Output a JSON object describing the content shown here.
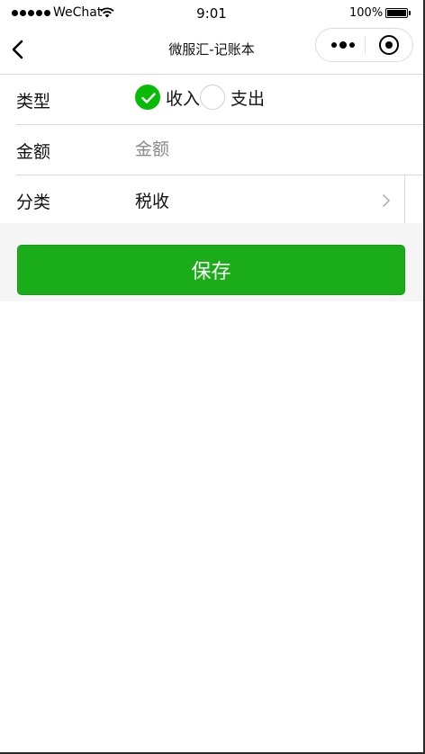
{
  "status_bar": {
    "carrier": "WeChat",
    "time": "9:01",
    "battery": "100%",
    "battery_level": 1.0
  },
  "nav": {
    "title": "微服汇-记账本",
    "back_icon": "chevron-left-icon",
    "more_icon": "more-dots-icon",
    "close_icon": "target-circle-icon"
  },
  "form": {
    "type": {
      "label": "类型",
      "options": [
        {
          "label": "收入",
          "checked": true
        },
        {
          "label": "支出",
          "checked": false
        }
      ]
    },
    "amount": {
      "label": "金额",
      "placeholder": "金额",
      "value": ""
    },
    "category": {
      "label": "分类",
      "value": "税收"
    }
  },
  "actions": {
    "save_label": "保存"
  },
  "colors": {
    "accent": "#1aad19",
    "radio_checked": "#09bb07",
    "page_bg": "#f5f5f5"
  }
}
